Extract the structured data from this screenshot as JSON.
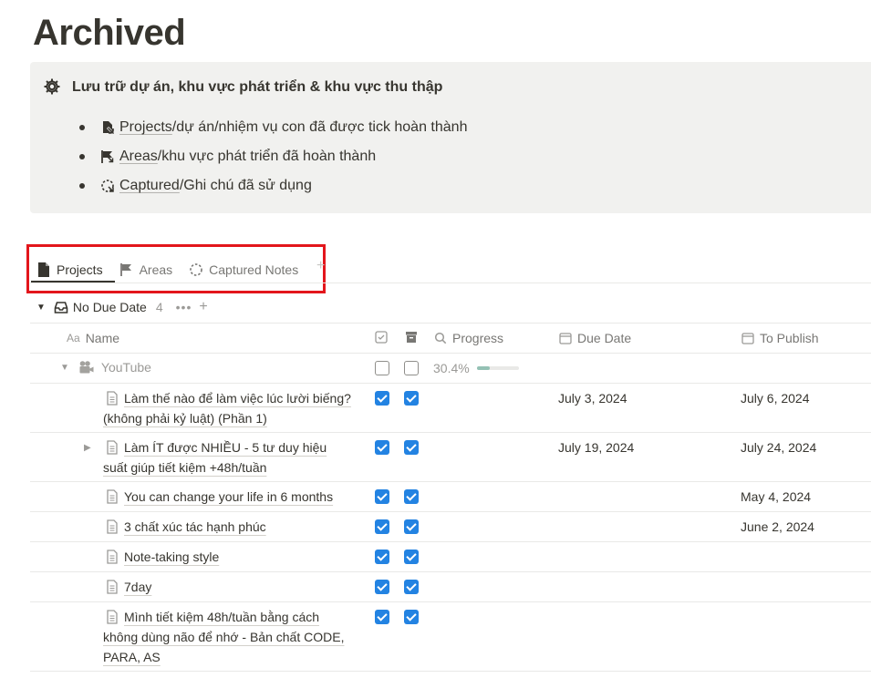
{
  "page": {
    "title": "Archived"
  },
  "callout": {
    "icon": "gear-icon",
    "title": "Lưu trữ dự án, khu vực phát triển & khu vực thu thập",
    "items": [
      {
        "icon": "document-arrow-icon",
        "link": "Projects",
        "text": "/dự án/nhiệm vụ con đã được tick hoàn thành"
      },
      {
        "icon": "flag-arrow-icon",
        "link": "Areas",
        "text": "/khu vực phát triển đã hoàn thành"
      },
      {
        "icon": "dashed-circle-icon",
        "link": "Captured",
        "text": "/Ghi chú đã sử dụng"
      }
    ]
  },
  "tabs": [
    {
      "label": "Projects",
      "icon": "document-icon",
      "active": true
    },
    {
      "label": "Areas",
      "icon": "flag-icon",
      "active": false
    },
    {
      "label": "Captured Notes",
      "icon": "dashed-circle-icon",
      "active": false
    }
  ],
  "group": {
    "title": "No Due Date",
    "count": "4"
  },
  "columns": {
    "name": "Name",
    "name_icon": "Aa",
    "progress": "Progress",
    "due_date": "Due Date",
    "to_publish": "To Publish"
  },
  "parent_row": {
    "title": "YouTube",
    "progress_text": "30.4%",
    "progress": 0.304,
    "check1": false,
    "check2": false
  },
  "rows": [
    {
      "lines": [
        "Làm thế nào để làm việc lúc lười biếng?",
        "(không phải kỷ luật) (Phần 1)"
      ],
      "due": "July 3, 2024",
      "publish": "July 6, 2024",
      "has_children": false
    },
    {
      "lines": [
        "Làm ÍT được NHIỀU - 5 tư duy hiệu",
        "suất giúp tiết kiệm +48h/tuần"
      ],
      "due": "July 19, 2024",
      "publish": "July 24, 2024",
      "has_children": true
    },
    {
      "lines": [
        "You can change your life in 6 months"
      ],
      "due": "",
      "publish": "May 4, 2024",
      "has_children": false
    },
    {
      "lines": [
        "3 chất xúc tác hạnh phúc"
      ],
      "due": "",
      "publish": "June 2, 2024",
      "has_children": false
    },
    {
      "lines": [
        "Note-taking style"
      ],
      "due": "",
      "publish": "",
      "has_children": false
    },
    {
      "lines": [
        "7day"
      ],
      "due": "",
      "publish": "",
      "has_children": false
    },
    {
      "lines": [
        "Mình tiết kiệm 48h/tuần bằng cách",
        "không dùng não để nhớ - Bản chất CODE,",
        "PARA, AS"
      ],
      "due": "",
      "publish": "",
      "has_children": false
    }
  ],
  "colors": {
    "accent": "#2383e2",
    "highlight": "#e3161c",
    "progress_fill": "#94c1b4"
  }
}
